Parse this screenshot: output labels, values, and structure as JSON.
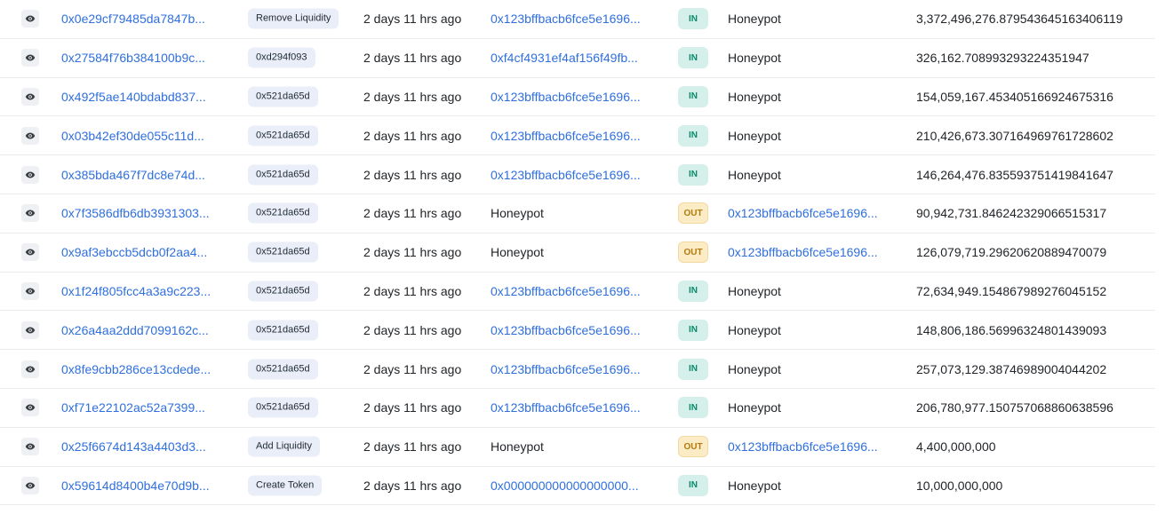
{
  "icons": {
    "view": "eye-icon"
  },
  "colors": {
    "link": "#2f6fde",
    "in_bg": "#d5f0ea",
    "in_fg": "#0a8a6a",
    "out_bg": "#fcecc6",
    "out_fg": "#b27a0c",
    "method_bg": "#e9eef8"
  },
  "rows": [
    {
      "hash": "0x0e29cf79485da7847b...",
      "method": "Remove Liquidity",
      "age": "2 days 11 hrs ago",
      "from": "0x123bffbacb6fce5e1696...",
      "direction": "IN",
      "to": "Honeypot",
      "quantity": "3,372,496,276.879543645163406119"
    },
    {
      "hash": "0x27584f76b384100b9c...",
      "method": "0xd294f093",
      "age": "2 days 11 hrs ago",
      "from": "0xf4cf4931ef4af156f49fb...",
      "direction": "IN",
      "to": "Honeypot",
      "quantity": "326,162.708993293224351947"
    },
    {
      "hash": "0x492f5ae140bdabd837...",
      "method": "0x521da65d",
      "age": "2 days 11 hrs ago",
      "from": "0x123bffbacb6fce5e1696...",
      "direction": "IN",
      "to": "Honeypot",
      "quantity": "154,059,167.453405166924675316"
    },
    {
      "hash": "0x03b42ef30de055c11d...",
      "method": "0x521da65d",
      "age": "2 days 11 hrs ago",
      "from": "0x123bffbacb6fce5e1696...",
      "direction": "IN",
      "to": "Honeypot",
      "quantity": "210,426,673.307164969761728602"
    },
    {
      "hash": "0x385bda467f7dc8e74d...",
      "method": "0x521da65d",
      "age": "2 days 11 hrs ago",
      "from": "0x123bffbacb6fce5e1696...",
      "direction": "IN",
      "to": "Honeypot",
      "quantity": "146,264,476.835593751419841647"
    },
    {
      "hash": "0x7f3586dfb6db3931303...",
      "method": "0x521da65d",
      "age": "2 days 11 hrs ago",
      "from": "Honeypot",
      "direction": "OUT",
      "to": "0x123bffbacb6fce5e1696...",
      "quantity": "90,942,731.846242329066515317"
    },
    {
      "hash": "0x9af3ebccb5dcb0f2aa4...",
      "method": "0x521da65d",
      "age": "2 days 11 hrs ago",
      "from": "Honeypot",
      "direction": "OUT",
      "to": "0x123bffbacb6fce5e1696...",
      "quantity": "126,079,719.29620620889470079"
    },
    {
      "hash": "0x1f24f805fcc4a3a9c223...",
      "method": "0x521da65d",
      "age": "2 days 11 hrs ago",
      "from": "0x123bffbacb6fce5e1696...",
      "direction": "IN",
      "to": "Honeypot",
      "quantity": "72,634,949.154867989276045152"
    },
    {
      "hash": "0x26a4aa2ddd7099162c...",
      "method": "0x521da65d",
      "age": "2 days 11 hrs ago",
      "from": "0x123bffbacb6fce5e1696...",
      "direction": "IN",
      "to": "Honeypot",
      "quantity": "148,806,186.56996324801439093"
    },
    {
      "hash": "0x8fe9cbb286ce13cdede...",
      "method": "0x521da65d",
      "age": "2 days 11 hrs ago",
      "from": "0x123bffbacb6fce5e1696...",
      "direction": "IN",
      "to": "Honeypot",
      "quantity": "257,073,129.38746989004044202"
    },
    {
      "hash": "0xf71e22102ac52a7399...",
      "method": "0x521da65d",
      "age": "2 days 11 hrs ago",
      "from": "0x123bffbacb6fce5e1696...",
      "direction": "IN",
      "to": "Honeypot",
      "quantity": "206,780,977.150757068860638596"
    },
    {
      "hash": "0x25f6674d143a4403d3...",
      "method": "Add Liquidity",
      "age": "2 days 11 hrs ago",
      "from": "Honeypot",
      "direction": "OUT",
      "to": "0x123bffbacb6fce5e1696...",
      "quantity": "4,400,000,000"
    },
    {
      "hash": "0x59614d8400b4e70d9b...",
      "method": "Create Token",
      "age": "2 days 11 hrs ago",
      "from": "0x000000000000000000...",
      "direction": "IN",
      "to": "Honeypot",
      "quantity": "10,000,000,000"
    }
  ]
}
